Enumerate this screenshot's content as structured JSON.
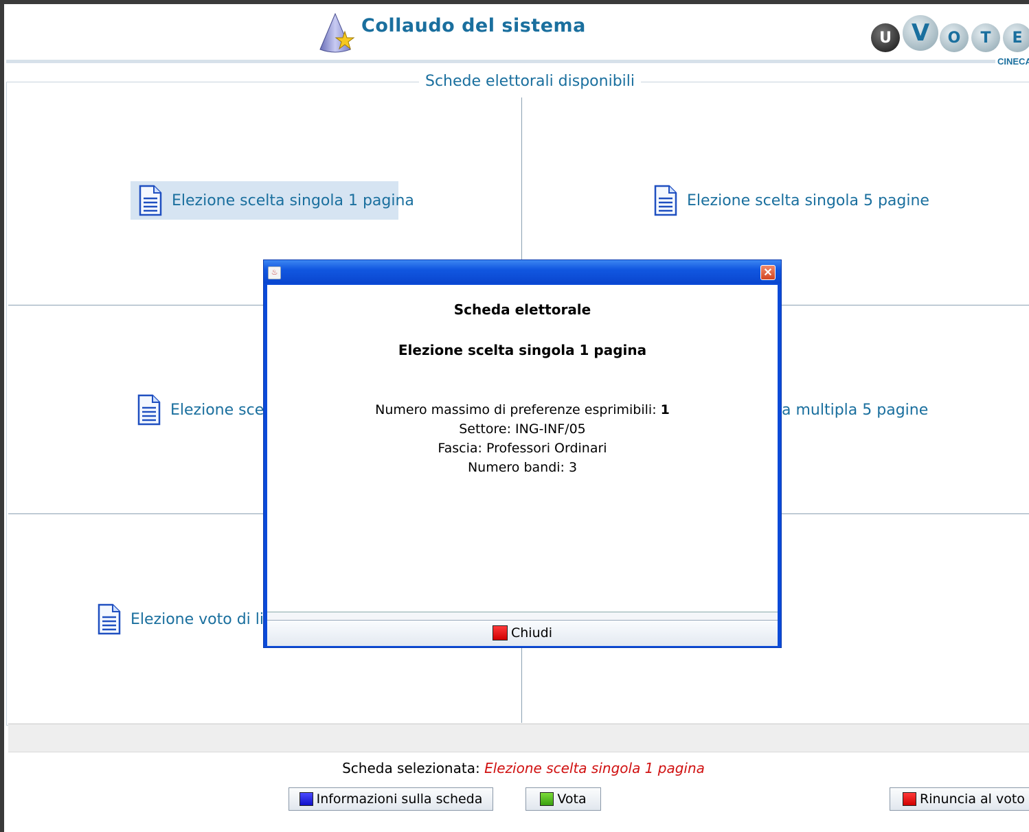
{
  "header": {
    "title": "Collaudo del sistema",
    "logo_letters": [
      "U",
      "V",
      "O",
      "T",
      "E"
    ],
    "logo_caption": "CINECA"
  },
  "group": {
    "legend": "Schede elettorali disponibili"
  },
  "ballots": [
    {
      "label": "Elezione scelta singola 1 pagina",
      "selected": true
    },
    {
      "label": "Elezione scelta singola 5 pagine",
      "selected": false
    },
    {
      "label": "Elezione scel",
      "selected": false
    },
    {
      "label": "a multipla 5 pagine",
      "selected": false
    },
    {
      "label": "Elezione voto di list",
      "selected": false
    }
  ],
  "selection": {
    "label": "Scheda selezionata:",
    "value": "Elezione scelta singola 1 pagina"
  },
  "buttons": {
    "info": "Informazioni sulla scheda",
    "vote": "Vota",
    "renounce": "Rinuncia al voto"
  },
  "dialog": {
    "title": "Scheda elettorale",
    "subtitle": "Elezione scelta singola 1 pagina",
    "max_pref_label": "Numero massimo di preferenze esprimibili: ",
    "max_pref_value": "1",
    "sector": "Settore: ING-INF/05",
    "band": "Fascia: Professori Ordinari",
    "calls": "Numero bandi: 3",
    "close_label": "Chiudi"
  },
  "colors": {
    "accent": "#1a6f9e",
    "selection_value": "#d01010",
    "dialog_frame": "#0b4ad8"
  }
}
